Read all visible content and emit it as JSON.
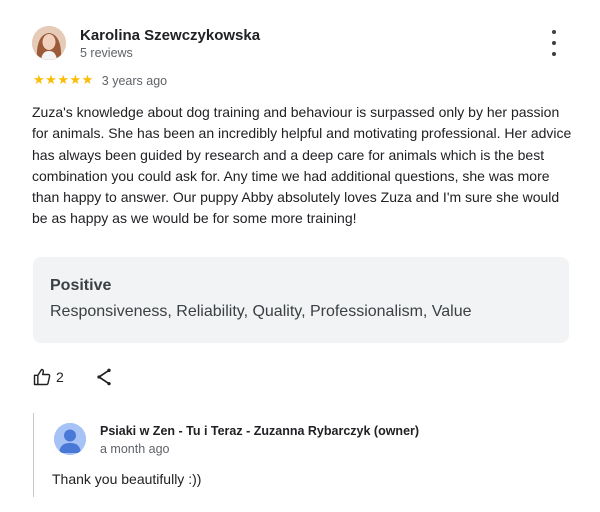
{
  "review": {
    "author_name": "Karolina Szewczykowska",
    "author_meta": "5 reviews",
    "rating": 5,
    "stars": [
      "★",
      "★",
      "★",
      "★",
      "★"
    ],
    "age": "3 years ago",
    "text": "Zuza's knowledge about dog training and behaviour is surpassed only by her passion for animals. She has been an incredibly helpful and motivating professional. Her advice has always been guided by research and a deep care for animals which is the best combination you could ask for. Any time we had additional questions, she was more than happy to answer. Our puppy Abby absolutely loves Zuza and I'm sure she would be as happy as we would be for some more training!",
    "highlights": {
      "title": "Positive",
      "items": "Responsiveness, Reliability, Quality, Professionalism, Value"
    },
    "likes": "2"
  },
  "owner_reply": {
    "name": "Psiaki w Zen - Tu i Teraz - Zuzanna Rybarczyk (owner)",
    "age": "a month ago",
    "text": "Thank you beautifully :))"
  },
  "icons": {
    "more": "more-vert-icon",
    "like": "thumb-up-icon",
    "share": "share-icon",
    "star": "star-icon",
    "owner_avatar": "person-icon"
  },
  "colors": {
    "star": "#fbbc04",
    "panel_bg": "#f1f3f4",
    "owner_avatar_bg": "#a7c2f5",
    "owner_avatar_fg": "#4a78d6"
  }
}
